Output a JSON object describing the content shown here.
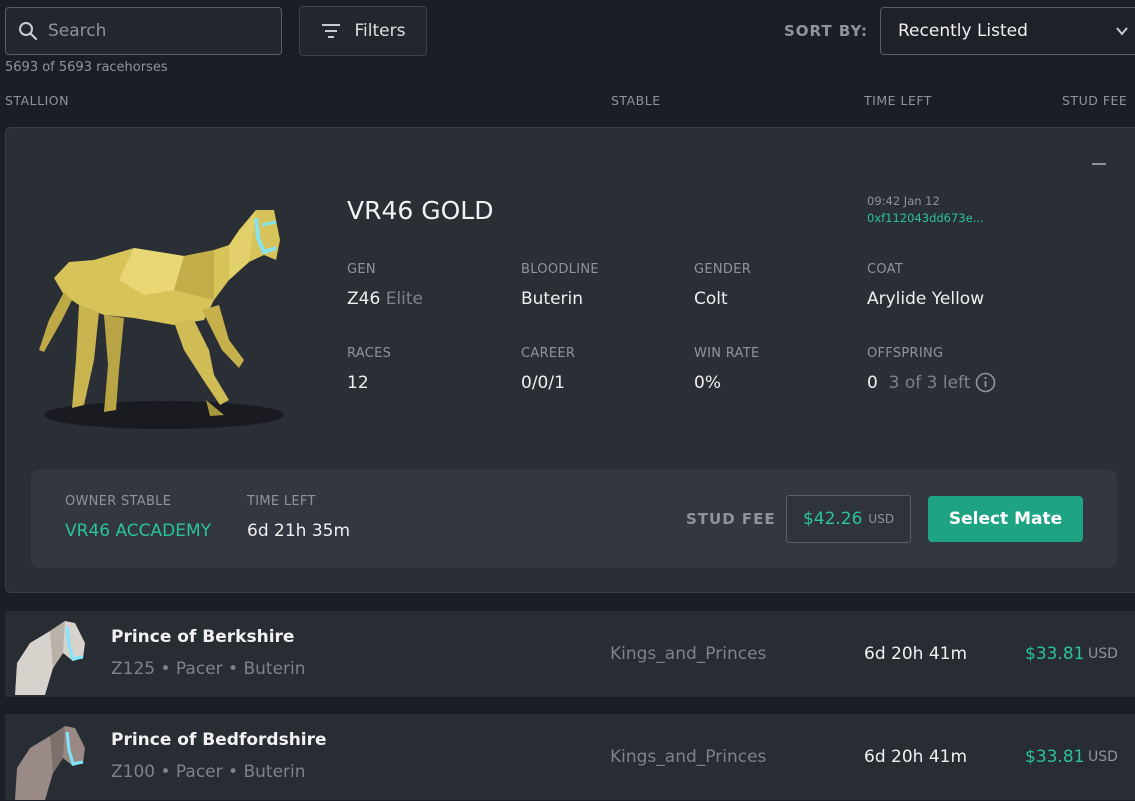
{
  "search": {
    "placeholder": "Search"
  },
  "filters": {
    "label": "Filters"
  },
  "sort": {
    "label": "SORT BY:",
    "selected": "Recently Listed"
  },
  "count": "5693 of 5693 racehorses",
  "columns": {
    "stallion": "STALLION",
    "stable": "STABLE",
    "time_left": "TIME LEFT",
    "stud_fee": "STUD FEE"
  },
  "featured": {
    "name": "VR46 GOLD",
    "listed_time": "09:42 Jan 12",
    "tx_hash": "0xf112043dd673e...",
    "stats": {
      "gen_label": "GEN",
      "gen_value": "Z46",
      "gen_tier": "Elite",
      "bloodline_label": "BLOODLINE",
      "bloodline_value": "Buterin",
      "gender_label": "GENDER",
      "gender_value": "Colt",
      "coat_label": "COAT",
      "coat_value": "Arylide Yellow",
      "races_label": "RACES",
      "races_value": "12",
      "career_label": "CAREER",
      "career_value": "0/0/1",
      "winrate_label": "WIN RATE",
      "winrate_value": "0%",
      "offspring_label": "OFFSPRING",
      "offspring_value": "0",
      "offspring_left": "3 of 3 left"
    },
    "owner_label": "OWNER STABLE",
    "owner_value": "VR46 ACCADEMY",
    "time_left_label": "TIME LEFT",
    "time_left_value": "6d 21h 35m",
    "stud_fee_label": "STUD FEE",
    "stud_fee_amount": "$42.26",
    "stud_fee_currency": "USD",
    "select_mate": "Select Mate"
  },
  "rows": [
    {
      "name": "Prince of Berkshire",
      "sub": "Z125 • Pacer • Buterin",
      "stable": "Kings_and_Princes",
      "time": "6d 20h 41m",
      "fee": "$33.81",
      "currency": "USD"
    },
    {
      "name": "Prince of Bedfordshire",
      "sub": "Z100 • Pacer • Buterin",
      "stable": "Kings_and_Princes",
      "time": "6d 20h 41m",
      "fee": "$33.81",
      "currency": "USD"
    }
  ],
  "colors": {
    "accent": "#2bc39a",
    "button": "#1fa483",
    "background": "#1b1e24",
    "card": "#2a2e35",
    "horse_gold": "#d6c35a"
  },
  "icons": {
    "search": "search-icon",
    "filters": "filter-lines-icon",
    "sort": "chevron-down-icon",
    "collapse": "minus-icon",
    "info": "info-circle-icon"
  }
}
